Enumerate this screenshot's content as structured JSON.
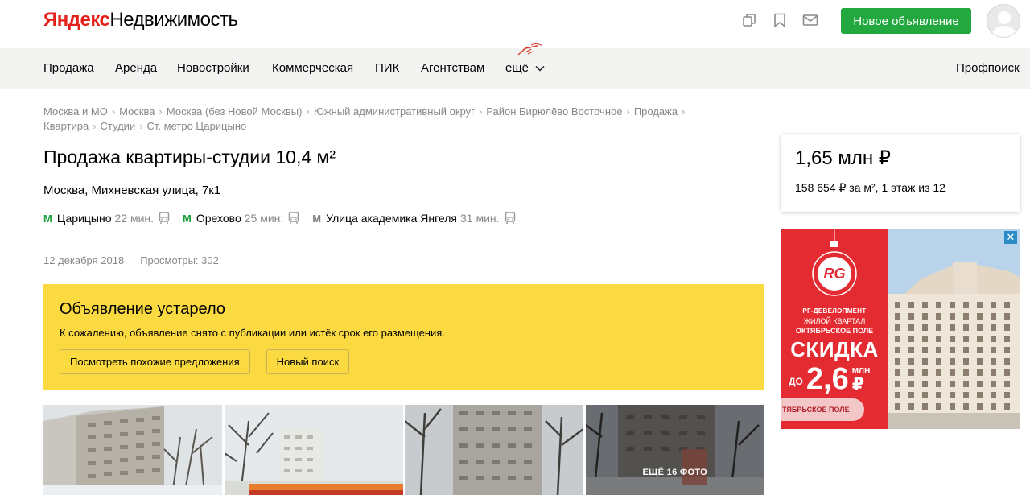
{
  "header": {
    "logo_brand": "Яндекс",
    "logo_product": "Недвижимость",
    "icons": [
      "compare-icon",
      "bookmark-icon",
      "mail-icon"
    ],
    "new_ad_label": "Новое объявление",
    "accent_color": "#22a83e"
  },
  "nav": {
    "items": [
      "Продажа",
      "Аренда",
      "Новостройки",
      "Коммерческая",
      "ПИК",
      "Агентствам"
    ],
    "more_label": "ещё",
    "search_label": "Профпоиск"
  },
  "breadcrumb": [
    "Москва и МО",
    "Москва",
    "Москва (без Новой Москвы)",
    "Южный административный округ",
    "Район Бирюлёво Восточное",
    "Продажа",
    "Квартира",
    "Студии",
    "Ст. метро Царицыно"
  ],
  "listing": {
    "title": "Продажа квартиры-студии 10,4 м²",
    "address": "Москва, Михневская улица, 7к1",
    "metro": [
      {
        "name": "Царицыно",
        "time": "22 мин."
      },
      {
        "name": "Орехово",
        "time": "25 мин."
      },
      {
        "name": "Улица академика Янгеля",
        "time": "31 мин."
      }
    ],
    "metro_logo": "М",
    "date": "12 декабря 2018",
    "views": "Просмотры: 302"
  },
  "outdated": {
    "heading": "Объявление устарело",
    "text": "К сожалению, объявление снято с публикации или истёк срок его размещения.",
    "similar_button": "Посмотреть похожие предложения",
    "new_search_button": "Новый поиск",
    "background_color": "#fbd940"
  },
  "gallery": {
    "more_label": "ЕЩЁ 16 ФОТО"
  },
  "price_card": {
    "price": "1,65 млн ₽",
    "details": "158 654 ₽ за м², 1 этаж из 12"
  },
  "ad": {
    "logo": "RG",
    "brand": "РГ-ДЕВЕЛОПМЕНТ",
    "line1": "ЖИЛОЙ КВАРТАЛ",
    "line2": "ОКТЯБРЬСКОЕ ПОЛЕ",
    "sale": "СКИДКА",
    "prefix": "ДО",
    "amount": "2,6",
    "unit_top": "МЛН",
    "unit_bottom": "₽",
    "pill": "ТЯБРЬСКОЕ ПОЛЕ",
    "close": "✕",
    "color": "#e42b31"
  }
}
